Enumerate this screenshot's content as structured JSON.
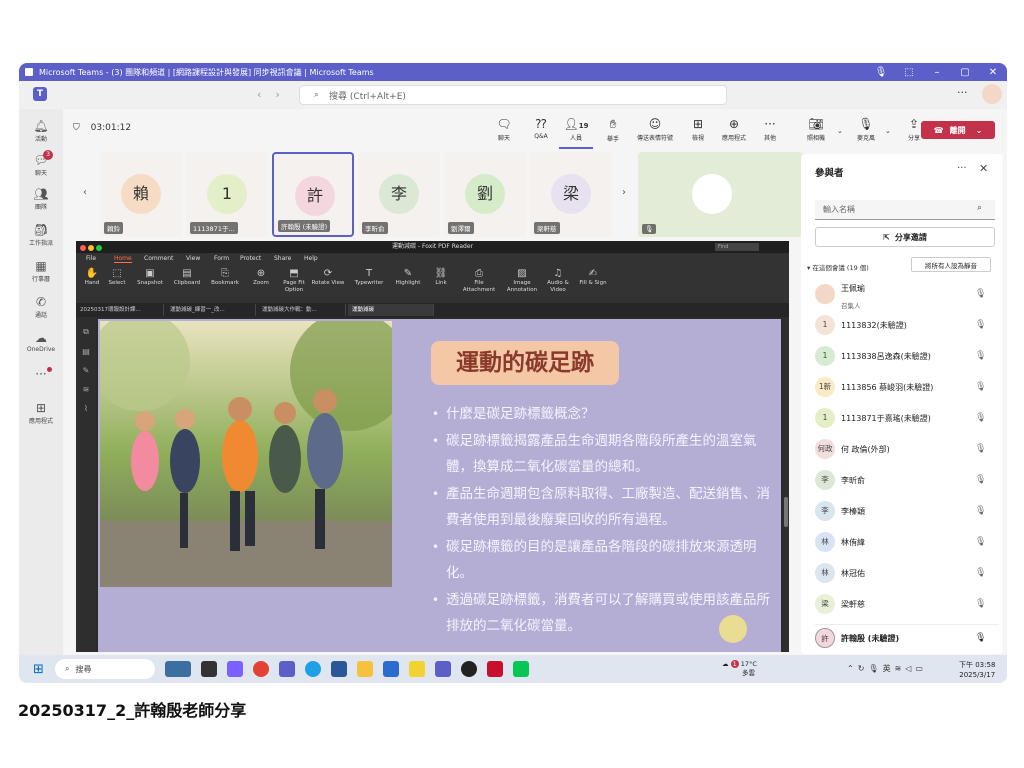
{
  "window": {
    "title": "Microsoft Teams - (3) 團隊和頻道 | [網路課程設計與發展] 同步視訊會議 | Microsoft Teams"
  },
  "header": {
    "search_placeholder": "搜尋 (Ctrl+Alt+E)"
  },
  "rail": {
    "activity": "活動",
    "chat": "聊天",
    "chat_badge": "3",
    "teams": "團隊",
    "assignments": "工作指派",
    "calendar": "行事曆",
    "calls": "通話",
    "onedrive": "OneDrive",
    "apps": "應用程式"
  },
  "meeting_toolbar": {
    "timer": "03:01:12",
    "chat": "聊天",
    "qa": "Q&A",
    "people": "人員",
    "people_count": "19",
    "raise": "舉手",
    "react": "傳送表情符號",
    "view": "檢視",
    "apps": "應用程式",
    "more": "其他",
    "camera": "照相機",
    "mic": "麥克風",
    "share": "分享",
    "leave": "離開"
  },
  "video_tiles": [
    {
      "avatar": "賴",
      "name": "賴鈴",
      "color": "#f6dcc4"
    },
    {
      "avatar": "1",
      "name": "1113871于...",
      "color": "#e3efc8"
    },
    {
      "avatar": "許",
      "name": "許翰殷 (未驗證)",
      "color": "#f4d6de"
    },
    {
      "avatar": "李",
      "name": "李昕俞",
      "color": "#dbe8d6"
    },
    {
      "avatar": "劉",
      "name": "劉澤爾",
      "color": "#d6ecc8"
    },
    {
      "avatar": "梁",
      "name": "梁軒慈",
      "color": "#e9e0f0"
    }
  ],
  "pdf": {
    "window_title": "運動減碳 - Foxit PDF Reader",
    "find": "Find",
    "menu": [
      "File",
      "Home",
      "Comment",
      "View",
      "Form",
      "Protect",
      "Share",
      "Help"
    ],
    "ribbon": [
      "Hand",
      "Select",
      "Snapshot",
      "Clipboard",
      "Bookmark",
      "Zoom",
      "Page Fit Option",
      "Rotate View",
      "Typewriter",
      "Highlight",
      "Link",
      "File Attachment",
      "Image Annotation",
      "Audio & Video",
      "Fill & Sign"
    ],
    "tabs": [
      "20250317環報設計課...",
      "運動減碳_練習一_改...",
      "運動減碳大作戰：動...",
      "運動減碳"
    ]
  },
  "slide": {
    "title": "運動的碳足跡",
    "bullets": [
      "什麼是碳足跡標籤概念？",
      "碳足跡標籤揭露產品生命週期各階段所產生的溫室氣體，換算成二氧化碳當量的總和。",
      "產品生命週期包含原料取得、工廠製造、配送銷售、消費者使用到最後廢棄回收的所有過程。",
      "碳足跡標籤的目的是讓產品各階段的碳排放來源透明化。",
      "透過碳足跡標籤，消費者可以了解購買或使用該產品所排放的二氧化碳當量。"
    ]
  },
  "panel": {
    "title": "參與者",
    "name_placeholder": "輸入名稱",
    "invite": "分享邀請",
    "in_meeting": "在這個會議 (19 個)",
    "mute_all": "將所有人設為靜音",
    "participants": [
      {
        "avatar": "",
        "name": "王佩瑜",
        "role": "召集人",
        "color": "#f3d8c8"
      },
      {
        "avatar": "1",
        "name": "1113832(未驗證)",
        "role": "",
        "color": "#f4e4d8"
      },
      {
        "avatar": "1",
        "name": "1113838呂逸森(未驗證)",
        "role": "",
        "color": "#d6ecd0"
      },
      {
        "avatar": "1新",
        "name": "1113856 蔡峻羽(未驗證)",
        "role": "",
        "color": "#fbeac6"
      },
      {
        "avatar": "1",
        "name": "1113871于熹瑤(未驗證)",
        "role": "",
        "color": "#e4efc8"
      },
      {
        "avatar": "何政",
        "name": "何 政倫(外部)",
        "role": "",
        "color": "#f3dede"
      },
      {
        "avatar": "李",
        "name": "李昕俞",
        "role": "",
        "color": "#dbe8d6"
      },
      {
        "avatar": "李",
        "name": "李榛穎",
        "role": "",
        "color": "#d8e6ef"
      },
      {
        "avatar": "林",
        "name": "林侑緯",
        "role": "",
        "color": "#d8e4f2"
      },
      {
        "avatar": "林",
        "name": "林冠佑",
        "role": "",
        "color": "#dbe6ee"
      },
      {
        "avatar": "梁",
        "name": "梁軒慈",
        "role": "",
        "color": "#e8f0d8"
      }
    ],
    "me": {
      "avatar": "許",
      "name": "許翰殷 (未驗證)",
      "color": "#f4d6de"
    }
  },
  "taskbar": {
    "search": "搜尋",
    "weather_temp": "17°C",
    "weather_desc": "多雲",
    "weather_badge": "1",
    "ime": "英",
    "time": "下午 03:58",
    "date": "2025/3/17"
  },
  "caption": "20250317_2_許翰殷老師分享"
}
